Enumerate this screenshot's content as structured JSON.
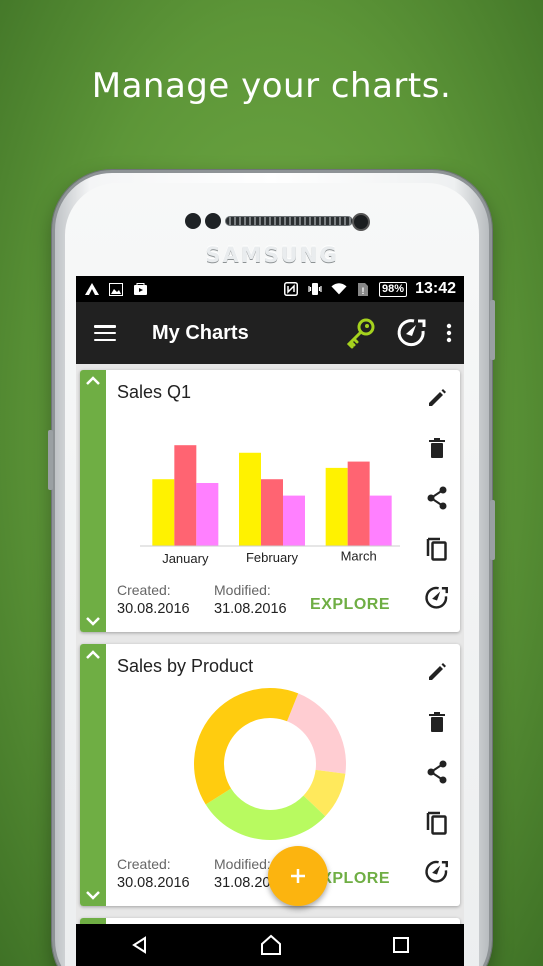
{
  "headline": "Manage your charts.",
  "device": {
    "brand": "SAMSUNG"
  },
  "statusbar": {
    "battery": "98%",
    "time": "13:42"
  },
  "appbar": {
    "title": "My Charts",
    "icons": [
      "menu-icon",
      "key-icon",
      "explore-icon",
      "more-vert-icon"
    ],
    "accent": "#a5d21e"
  },
  "cards": [
    {
      "title": "Sales Q1",
      "created_label": "Created:",
      "created": "30.08.2016",
      "modified_label": "Modified:",
      "modified": "31.08.2016",
      "explore_label": "EXPLORE"
    },
    {
      "title": "Sales by Product",
      "created_label": "Created:",
      "created": "30.08.2016",
      "modified_label": "Modified:",
      "modified": "31.08.2016",
      "explore_label": "EXPLORE"
    }
  ],
  "card_icons": [
    "edit-icon",
    "delete-icon",
    "share-icon",
    "copy-icon",
    "explore-icon"
  ],
  "colors": {
    "accent": "#6fae44",
    "fab": "#fcb40f",
    "appbar": "#212121"
  },
  "chart_data": [
    {
      "type": "bar",
      "categories": [
        "January",
        "February",
        "March"
      ],
      "series": [
        {
          "values": [
            53,
            74,
            62
          ],
          "color": "#fff200"
        },
        {
          "values": [
            80,
            53,
            67
          ],
          "color": "#ff6472"
        },
        {
          "values": [
            50,
            40,
            40
          ],
          "color": "#ff80ff"
        }
      ],
      "ylim": [
        0,
        100
      ]
    },
    {
      "type": "pie",
      "donut": true,
      "slices": [
        {
          "value": 21,
          "color": "#ffcdd2"
        },
        {
          "value": 10,
          "color": "#ffe95c"
        },
        {
          "value": 29,
          "color": "#b8fa60"
        },
        {
          "value": 40,
          "color": "#ffcc0f"
        }
      ]
    }
  ]
}
